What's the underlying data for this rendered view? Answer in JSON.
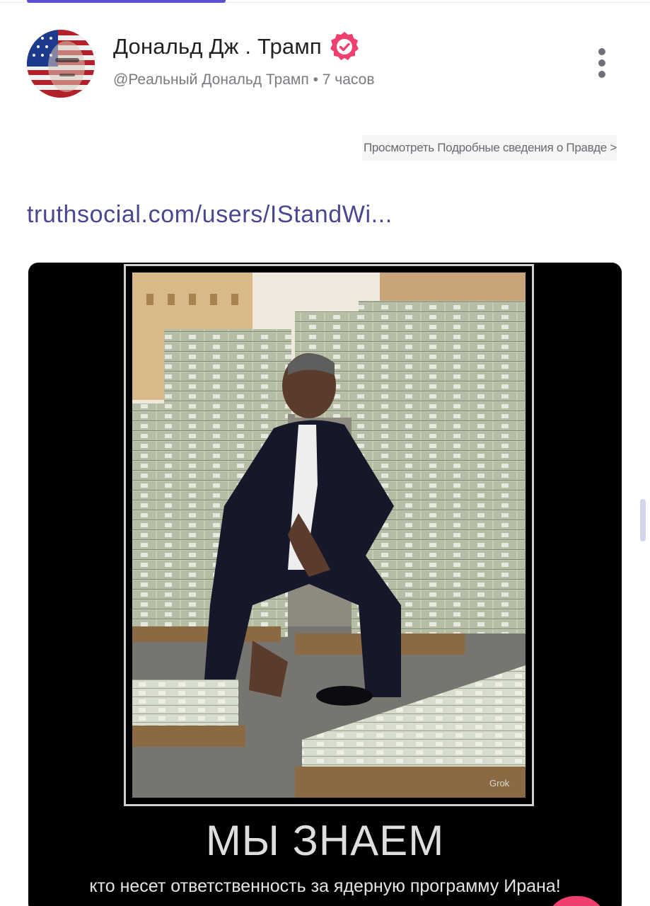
{
  "post": {
    "display_name": "Дональд Дж . Трамп",
    "handle": "@Реальный Дональд Трамп",
    "separator": "•",
    "time_ago": "7 часов",
    "details_link": "Просмотреть Подробные сведения о Правде >",
    "link_text": "truthsocial.com/users/IStandWi...",
    "link_color": "#4b4691"
  },
  "media": {
    "caption_main": "МЫ ЗНАЕМ",
    "caption_sub": "кто несет ответственность за ядерную программу Ирана!",
    "watermark": "Grok"
  },
  "colors": {
    "accent": "#5b4fd6",
    "verified_badge": "#ef3f6f",
    "text_primary": "#222222",
    "text_secondary": "#7a7a80"
  },
  "icons": {
    "verified": "verified-check-badge-icon",
    "more_menu": "vertical-dots-icon"
  }
}
